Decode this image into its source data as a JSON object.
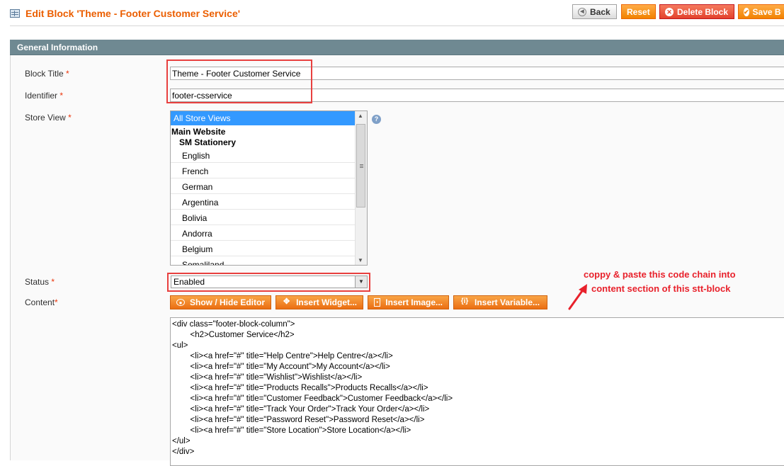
{
  "header": {
    "title": "Edit Block 'Theme - Footer Customer Service'",
    "buttons": {
      "back": "Back",
      "reset": "Reset",
      "delete": "Delete Block",
      "save": "Save B"
    }
  },
  "section": {
    "title": "General Information"
  },
  "form": {
    "block_title": {
      "label": "Block Title",
      "value": "Theme - Footer Customer Service"
    },
    "identifier": {
      "label": "Identifier",
      "value": "footer-csservice"
    },
    "store_view": {
      "label": "Store View",
      "selected": "All Store Views",
      "website": "Main Website",
      "store": "SM Stationery",
      "options": [
        "English",
        "French",
        "German",
        "Argentina",
        "Bolivia",
        "Andorra",
        "Belgium",
        "Somaliland"
      ],
      "help": "?"
    },
    "status": {
      "label": "Status",
      "value": "Enabled"
    },
    "content": {
      "label": "Content",
      "buttons": {
        "show_hide": "Show / Hide Editor",
        "widget": "Insert Widget...",
        "image": "Insert Image...",
        "variable": "Insert Variable..."
      },
      "lines": [
        "<div class=\"footer-block-column\">",
        "        <h2>Customer Service</h2>",
        "<ul>",
        "        <li><a href=\"#\" title=\"Help Centre\">Help Centre</a></li>",
        "        <li><a href=\"#\" title=\"My Account\">My Account</a></li>",
        "        <li><a href=\"#\" title=\"Wishlist\">Wishlist</a></li>",
        "        <li><a href=\"#\" title=\"Products Recalls\">Products Recalls</a></li>",
        "        <li><a href=\"#\" title=\"Customer Feedback\">Customer Feedback</a></li>",
        "        <li><a href=\"#\" title=\"Track Your Order\">Track Your Order</a></li>",
        "        <li><a href=\"#\" title=\"Password Reset\">Password Reset</a></li>",
        "        <li><a href=\"#\" title=\"Store Location\">Store Location</a></li>",
        "</ul>",
        "</div>"
      ]
    },
    "required_mark": "*"
  },
  "annotation": {
    "line1": "coppy & paste this code chain into",
    "line2": "content section of this stt-block"
  },
  "colors": {
    "title": "#eb5e00",
    "button": "#f18200",
    "delete": "#e3412c",
    "section": "#6f8992",
    "highlight": "#e8403f",
    "annotation": "#e8212b"
  }
}
